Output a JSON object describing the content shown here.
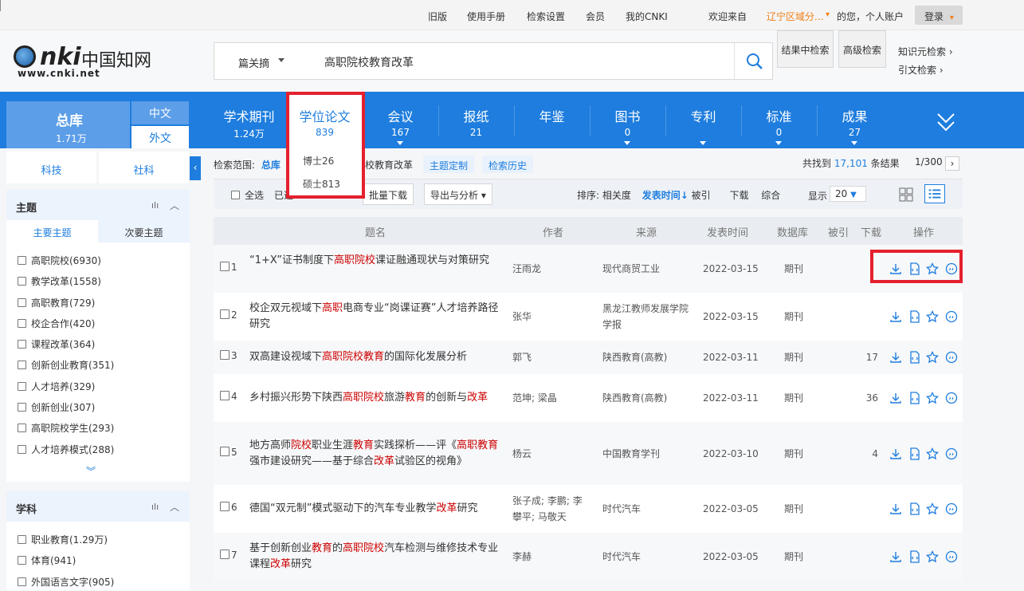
{
  "topbar": {
    "links": [
      "旧版",
      "使用手册",
      "检索设置",
      "会员",
      "我的CNKI"
    ],
    "welcome": "欢迎来自",
    "region": "辽宁区域分...",
    "greeting": "的您，个人账户",
    "login": "登录"
  },
  "logo": {
    "url_text": "www.cnki.net",
    "brand_letters": "nki",
    "brand_cn": "中国知网"
  },
  "search": {
    "field": "篇关摘",
    "value": "高职院校教育改革",
    "in_results": "结果中检索",
    "advanced": "高级检索"
  },
  "side_links": [
    "知识元检索",
    "引文检索"
  ],
  "nav": {
    "main": {
      "label": "总库",
      "count": "1.71万"
    },
    "langs": [
      "中文",
      "外文"
    ],
    "items": [
      {
        "label": "学术期刊",
        "count": "1.24万"
      },
      {
        "label": "学位论文",
        "count": "839"
      },
      {
        "label": "会议",
        "count": "167"
      },
      {
        "label": "报纸",
        "count": "21"
      },
      {
        "label": "年鉴",
        "count": ""
      },
      {
        "label": "图书",
        "count": "0"
      },
      {
        "label": "专利",
        "count": ""
      },
      {
        "label": "标准",
        "count": "0"
      },
      {
        "label": "成果",
        "count": "27"
      }
    ],
    "dropdown": [
      "博士26",
      "硕士813"
    ]
  },
  "sidebar": {
    "tabs": [
      "科技",
      "社科"
    ],
    "collapse_icon": "‹",
    "theme": {
      "title": "主题",
      "subtabs": [
        "主要主题",
        "次要主题"
      ],
      "items": [
        "高职院校(6930)",
        "教学改革(1558)",
        "高职教育(729)",
        "校企合作(420)",
        "课程改革(364)",
        "创新创业教育(351)",
        "人才培养(329)",
        "创新创业(307)",
        "高职院校学生(293)",
        "人才培养模式(288)"
      ]
    },
    "subject": {
      "title": "学科",
      "items": [
        "职业教育(1.29万)",
        "体育(941)",
        "外国语言文字(905)"
      ]
    }
  },
  "results": {
    "scope_label": "检索范围:",
    "scope_value": "总库",
    "scope_query": "校教育改革",
    "tags": [
      "主题定制",
      "检索历史"
    ],
    "total_prefix": "共找到",
    "total": "17,101",
    "total_suffix": "条结果",
    "page": "1/300",
    "select_all": "全选",
    "selected": "已选",
    "batch_download": "批量下载",
    "export": "导出与分析",
    "sort_label": "排序:",
    "sort_options": [
      "相关度",
      "发表时间↓",
      "被引",
      "下载",
      "综合"
    ],
    "display_label": "显示",
    "page_size": "20",
    "columns": [
      "题名",
      "作者",
      "来源",
      "发表时间",
      "数据库",
      "被引",
      "下载",
      "操作"
    ],
    "rows": [
      {
        "num": "1",
        "title_parts": [
          [
            "“1+X”证书制度下",
            0
          ],
          [
            "高职院校",
            1
          ],
          [
            "课证融通现状与对策研究",
            0
          ]
        ],
        "author": "汪雨龙",
        "source": "现代商贸工业",
        "date": "2022-03-15",
        "db": "期刊",
        "cite": "",
        "download": ""
      },
      {
        "num": "2",
        "title_parts": [
          [
            "校企双元视域下",
            0
          ],
          [
            "高职",
            1
          ],
          [
            "电商专业“岗课证赛”人才培养路径研究",
            0
          ]
        ],
        "author": "张华",
        "source": "黑龙江教师发展学院学报",
        "date": "2022-03-15",
        "db": "期刊",
        "cite": "",
        "download": ""
      },
      {
        "num": "3",
        "title_parts": [
          [
            "双高建设视域下",
            0
          ],
          [
            "高职院校教育",
            1
          ],
          [
            "的国际化发展分析",
            0
          ]
        ],
        "author": "郭飞",
        "source": "陕西教育(高教)",
        "date": "2022-03-11",
        "db": "期刊",
        "cite": "",
        "download": "17"
      },
      {
        "num": "4",
        "title_parts": [
          [
            "乡村振兴形势下陕西",
            0
          ],
          [
            "高职院校",
            1
          ],
          [
            "旅游",
            0
          ],
          [
            "教育",
            1
          ],
          [
            "的创新与",
            0
          ],
          [
            "改革",
            1
          ]
        ],
        "author": "范坤; 梁晶",
        "source": "陕西教育(高教)",
        "date": "2022-03-11",
        "db": "期刊",
        "cite": "",
        "download": "36"
      },
      {
        "num": "5",
        "title_parts": [
          [
            "地方高师",
            0
          ],
          [
            "院校",
            1
          ],
          [
            "职业生涯",
            0
          ],
          [
            "教育",
            1
          ],
          [
            "实践探析——评《",
            0
          ],
          [
            "高职教育",
            1
          ],
          [
            "强市建设研究——基于综合",
            0
          ],
          [
            "改革",
            1
          ],
          [
            "试验区的视角》",
            0
          ]
        ],
        "author": "杨云",
        "source": "中国教育学刊",
        "date": "2022-03-10",
        "db": "期刊",
        "cite": "",
        "download": "4"
      },
      {
        "num": "6",
        "title_parts": [
          [
            "德国“双元制”模式驱动下的汽车专业教学",
            0
          ],
          [
            "改革",
            1
          ],
          [
            "研究",
            0
          ]
        ],
        "author": "张子成; 李鹏; 李攀平; 马敬天",
        "source": "时代汽车",
        "date": "2022-03-05",
        "db": "期刊",
        "cite": "",
        "download": ""
      },
      {
        "num": "7",
        "title_parts": [
          [
            "基于创新创业",
            0
          ],
          [
            "教育",
            1
          ],
          [
            "的",
            0
          ],
          [
            "高职院校",
            1
          ],
          [
            "汽车检测与维修技术专业课程",
            0
          ],
          [
            "改革",
            1
          ],
          [
            "研究",
            0
          ]
        ],
        "author": "李赫",
        "source": "时代汽车",
        "date": "2022-03-05",
        "db": "期刊",
        "cite": "",
        "download": ""
      }
    ]
  },
  "colors": {
    "brand": "#1e7dde",
    "highlight": "#cc0000",
    "annotation": "#e5202e"
  }
}
